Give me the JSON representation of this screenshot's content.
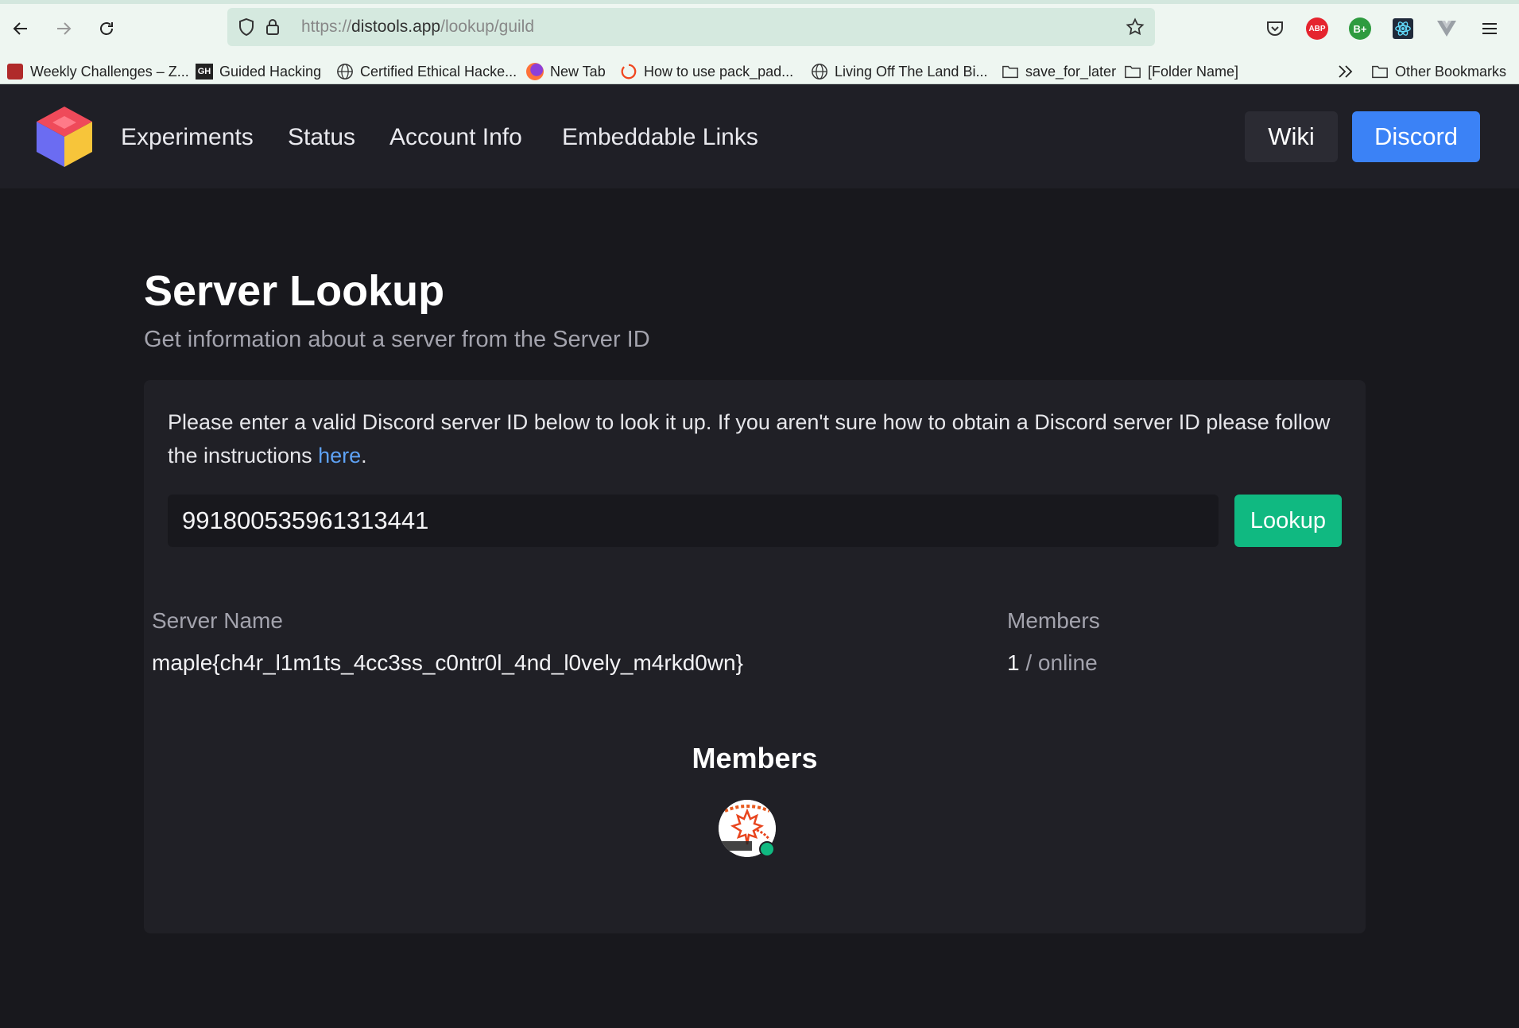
{
  "browser": {
    "url_prefix": "https://",
    "url_host": "distools.app",
    "url_path": "/lookup/guild",
    "extensions": {
      "abp_label": "ABP",
      "bplus_label": "B+"
    },
    "bookmarks": [
      {
        "label": "Weekly Challenges – Z...",
        "icon": "challenge-icon"
      },
      {
        "label": "Guided Hacking",
        "icon": "gh-icon",
        "badge": "GH"
      },
      {
        "label": "Certified Ethical Hacke...",
        "icon": "globe-icon"
      },
      {
        "label": "New Tab",
        "icon": "firefox-icon"
      },
      {
        "label": "How to use pack_pad...",
        "icon": "spinner-icon"
      },
      {
        "label": "Living Off The Land Bi...",
        "icon": "globe-icon"
      },
      {
        "label": "save_for_later",
        "icon": "folder-icon"
      },
      {
        "label": "[Folder Name]",
        "icon": "folder-icon"
      }
    ],
    "other_bookmarks": "Other Bookmarks"
  },
  "site": {
    "nav": [
      "Experiments",
      "Status",
      "Account Info",
      "Embeddable Links"
    ],
    "wiki_label": "Wiki",
    "discord_label": "Discord"
  },
  "page": {
    "title": "Server Lookup",
    "subtitle": "Get information about a server from the Server ID",
    "intro_text": "Please enter a valid Discord server ID below to look it up. If you aren't sure how to obtain a Discord server ID please follow the instructions ",
    "intro_link": "here",
    "intro_end": ".",
    "input_value": "991800535961313441",
    "lookup_label": "Lookup",
    "table": {
      "col_name": "Server Name",
      "col_members": "Members",
      "server_name": "maple{ch4r_l1m1ts_4cc3ss_c0ntr0l_4nd_l0vely_m4rkd0wn}",
      "member_count": "1",
      "member_suffix": "/ online"
    },
    "members_heading": "Members"
  },
  "colors": {
    "accent_blue": "#3b82f6",
    "accent_green": "#10b981",
    "link": "#5ea2f5",
    "background": "#18181d",
    "card": "#202026"
  }
}
